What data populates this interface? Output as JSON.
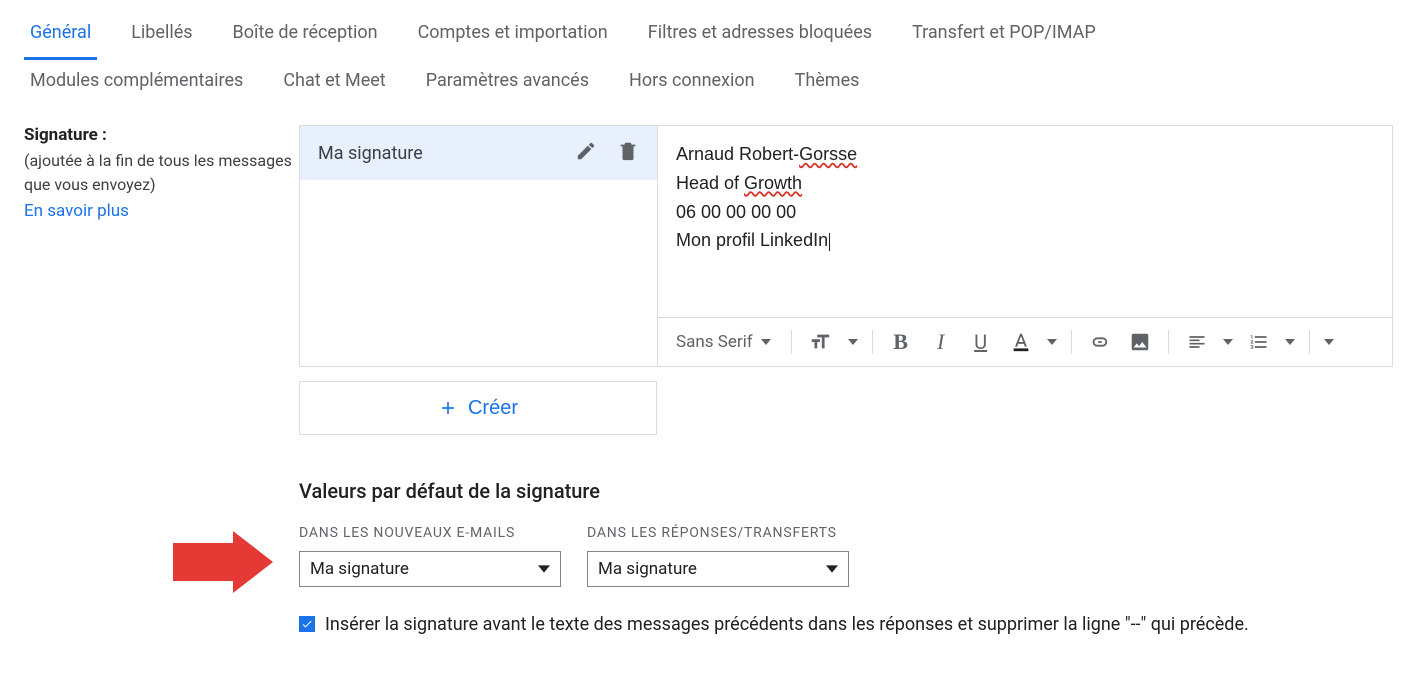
{
  "tabs": {
    "row1": [
      "Général",
      "Libellés",
      "Boîte de réception",
      "Comptes et importation",
      "Filtres et adresses bloquées",
      "Transfert et POP/IMAP"
    ],
    "row2": [
      "Modules complémentaires",
      "Chat et Meet",
      "Paramètres avancés",
      "Hors connexion",
      "Thèmes"
    ],
    "active_index": 0
  },
  "signature": {
    "title": "Signature :",
    "description": "(ajoutée à la fin de tous les messages que vous envoyez)",
    "learn_more": "En savoir plus",
    "item_name": "Ma signature",
    "content": {
      "name_prefix": "Arnaud Robert-",
      "name_mis": "Gorsse",
      "role_prefix": "Head of ",
      "role_mis": "Growth",
      "phone": "06 00 00 00 00",
      "linkedin": "Mon profil LinkedIn"
    },
    "toolbar": {
      "font_family": "Sans Serif"
    },
    "create_label": "Créer"
  },
  "defaults": {
    "heading": "Valeurs par défaut de la signature",
    "new_label": "DANS LES NOUVEAUX E-MAILS",
    "reply_label": "DANS LES RÉPONSES/TRANSFERTS",
    "new_value": "Ma signature",
    "reply_value": "Ma signature",
    "checkbox_text": "Insérer la signature avant le texte des messages précédents dans les réponses et supprimer la ligne \"--\" qui précède."
  }
}
